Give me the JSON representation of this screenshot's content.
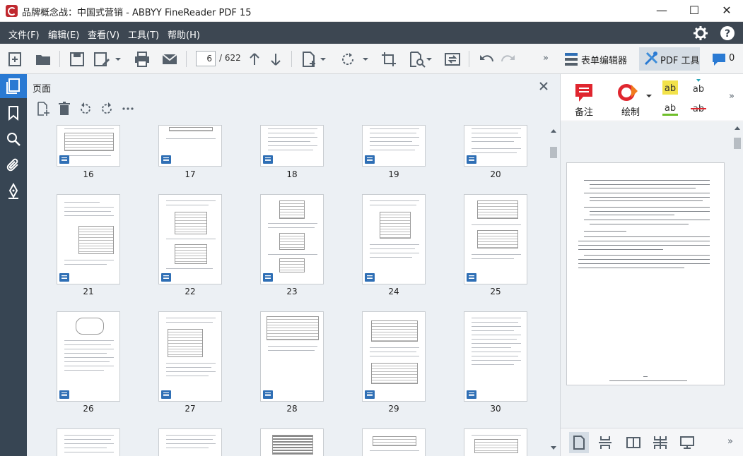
{
  "window": {
    "title": "品牌概念战：中国式营销 - ABBYY FineReader PDF 15",
    "minimize": "—",
    "maximize": "☐",
    "close": "✕"
  },
  "menu": [
    "文件(F)",
    "编辑(E)",
    "查看(V)",
    "工具(T)",
    "帮助(H)"
  ],
  "toolbar": {
    "current_page": "6",
    "total_pages": "/ 622",
    "form_editor": "表单编辑器",
    "pdf_tools": "PDF 工具",
    "comment_count": "0",
    "more": "»"
  },
  "pages_panel": {
    "title": "页面"
  },
  "thumbnails": {
    "row1": [
      "16",
      "17",
      "18",
      "19",
      "20"
    ],
    "row2": [
      "21",
      "22",
      "23",
      "24",
      "25"
    ],
    "row3": [
      "26",
      "27",
      "28",
      "29",
      "30"
    ]
  },
  "right_tools": {
    "note": "备注",
    "draw": "绘制",
    "more": "»"
  },
  "colors": {
    "menubar": "#3d4752",
    "rail": "#374553",
    "accent": "#2a7ad3",
    "note_red": "#e0262f"
  }
}
